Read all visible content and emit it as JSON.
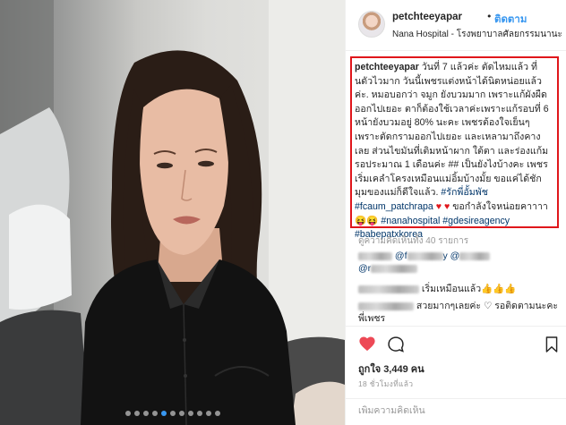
{
  "post": {
    "username": "petchteeyapar",
    "separator": "•",
    "follow_label": "ติดตาม",
    "location": "Nana Hospital - โรงพยาบาลศัลยกรรมนานะ"
  },
  "caption": {
    "username": "petchteeyapar",
    "part1": " วันที่ 7 แล้วค่ะ ตัดไหมแล้ว ที่นดัวไวมาก วันนี้เพชรแต่งหน้าได้นิดหน่อยแล้วค่ะ. หมอบอกว่า จมูก ยังบวมมาก เพราะแก้ผังผืดออกไปเยอะ ตาก็ต้องใช้เวลาค่ะเพราะแก้รอบที่ 6 หน้ายังบวมอยู่ 80% นะคะ เพชรต้องใจเย็นๆ เพราะตัดกรามออกไปเยอะ และเหลามาถึงคางเลย ส่วนไขมันที่เติมหน้าผาก ใต้ตา และร่องแก้ม รอประมาณ 1 เดือนค่ะ ## เป็นยังไงบ้างคะ เพชรเริ่มเคลำโครงเหมือนแม่อิ้มบ้างมั้ย ขอแค่ได้ชักมุมของแม่ก็ดีใจแล้ว. ",
    "tag1": "#รักพี่อั้มพัช",
    "tag2": "#fcaum_patchrapa",
    "hearts": "♥ ♥",
    "part2": " ขอกำลังใจหน่อยคาาาา ",
    "emoji": "😝😝",
    "tag3": "#nanahospital",
    "tag4": "#gdesireagency",
    "tag5": "#babepatxkorea"
  },
  "comments": {
    "view_all": "ดูความคิดเห็นทั้ง 40 รายการ",
    "c1_mention_a": "@f",
    "c1_mention_b": "y @",
    "c1_line2": "@r",
    "c2_text": "เริ่มเหมือนแล้ว👍👍👍",
    "c3_text": "สวยมากๆเลยค่ะ ♡ รอติดตามนะคะ",
    "c3_line2": "พี่เพชร"
  },
  "stats": {
    "likes": "ถูกใจ 3,449 คน",
    "time_ago": "18 ชั่วโมงที่แล้ว"
  },
  "add_comment": {
    "placeholder": "เพิ่มความคิดเห็น"
  },
  "carousel": {
    "total": 11,
    "active_index": 4
  },
  "colors": {
    "highlight_border": "#e0161b",
    "accent": "#3897f0",
    "heart": "#ed4956"
  },
  "icons": {
    "like": "heart-filled-icon",
    "comment": "comment-icon",
    "save": "bookmark-icon"
  }
}
